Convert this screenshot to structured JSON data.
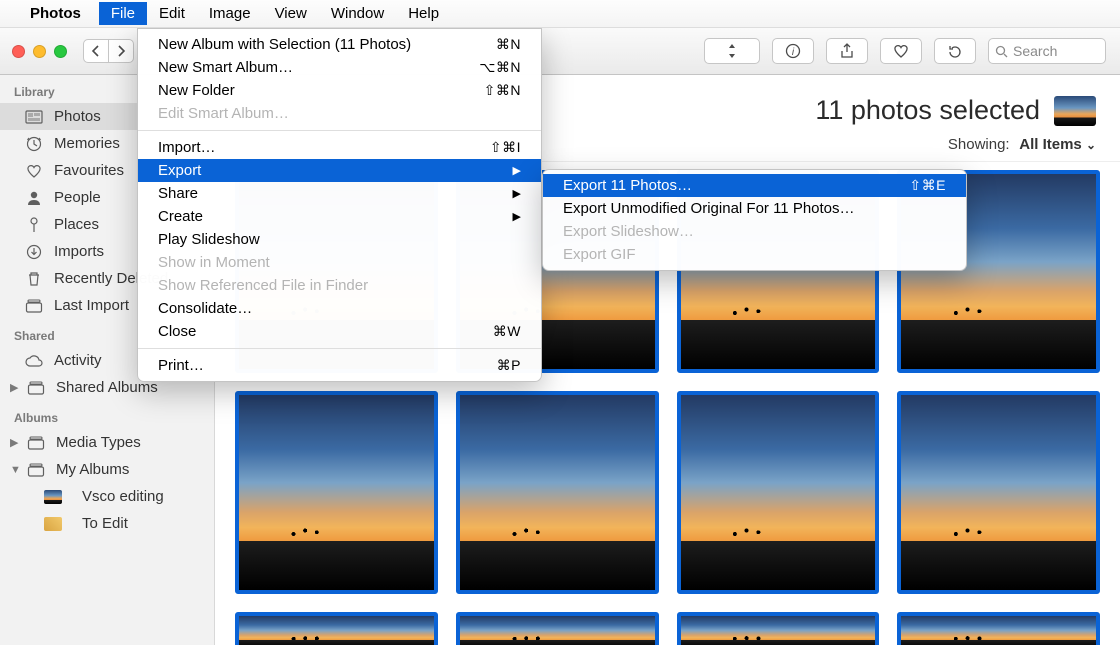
{
  "menubar": {
    "app_name": "Photos",
    "items": [
      "File",
      "Edit",
      "Image",
      "View",
      "Window",
      "Help"
    ],
    "active_index": 0
  },
  "toolbar": {
    "search_placeholder": "Search"
  },
  "sidebar": {
    "sections": [
      {
        "title": "Library",
        "items": [
          {
            "icon": "photos",
            "label": "Photos",
            "selected": true
          },
          {
            "icon": "clock",
            "label": "Memories"
          },
          {
            "icon": "heart",
            "label": "Favourites"
          },
          {
            "icon": "person",
            "label": "People"
          },
          {
            "icon": "pin",
            "label": "Places"
          },
          {
            "icon": "download",
            "label": "Imports"
          },
          {
            "icon": "trash",
            "label": "Recently Deleted"
          },
          {
            "icon": "stack",
            "label": "Last Import"
          }
        ]
      },
      {
        "title": "Shared",
        "items": [
          {
            "icon": "cloud",
            "label": "Activity"
          },
          {
            "icon": "stack",
            "label": "Shared Albums",
            "disclosure": "▶"
          }
        ]
      },
      {
        "title": "Albums",
        "items": [
          {
            "icon": "stack",
            "label": "Media Types",
            "disclosure": "▶"
          },
          {
            "icon": "stack",
            "label": "My Albums",
            "disclosure": "▼",
            "children": [
              {
                "thumb": "sunset",
                "label": "Vsco editing"
              },
              {
                "thumb": "gold",
                "label": "To Edit"
              }
            ]
          }
        ]
      }
    ]
  },
  "content": {
    "selection_label": "11 photos selected",
    "showing_label": "Showing:",
    "showing_value": "All Items"
  },
  "file_menu": [
    {
      "label": "New Album with Selection (11 Photos)",
      "shortcut": "⌘N"
    },
    {
      "label": "New Smart Album…",
      "shortcut": "⌥⌘N"
    },
    {
      "label": "New Folder",
      "shortcut": "⇧⌘N"
    },
    {
      "label": "Edit Smart Album…",
      "disabled": true
    },
    {
      "sep": true
    },
    {
      "label": "Import…",
      "shortcut": "⇧⌘I"
    },
    {
      "label": "Export",
      "submenu": true,
      "highlight": true
    },
    {
      "label": "Share",
      "submenu": true
    },
    {
      "label": "Create",
      "submenu": true
    },
    {
      "label": "Play Slideshow"
    },
    {
      "label": "Show in Moment",
      "disabled": true
    },
    {
      "label": "Show Referenced File in Finder",
      "disabled": true
    },
    {
      "label": "Consolidate…"
    },
    {
      "label": "Close",
      "shortcut": "⌘W"
    },
    {
      "sep": true
    },
    {
      "label": "Print…",
      "shortcut": "⌘P"
    }
  ],
  "export_menu": [
    {
      "label": "Export 11 Photos…",
      "shortcut": "⇧⌘E",
      "highlight": true
    },
    {
      "label": "Export Unmodified Original For 11 Photos…"
    },
    {
      "label": "Export Slideshow…",
      "disabled": true
    },
    {
      "label": "Export GIF",
      "disabled": true
    }
  ]
}
